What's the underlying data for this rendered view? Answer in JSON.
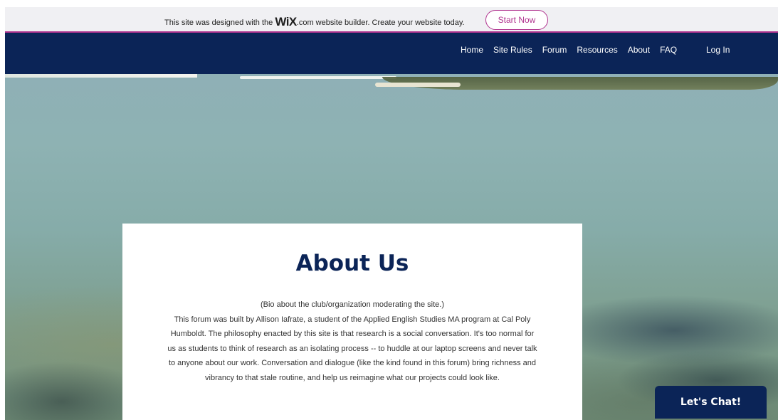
{
  "wix_banner": {
    "text_before": "This site was designed with the ",
    "logo_wix": "WiX",
    "logo_com": ".com",
    "text_after": " website builder. Create your website today.",
    "button_label": "Start Now"
  },
  "header": {
    "nav": [
      "Home",
      "Site Rules",
      "Forum",
      "Resources",
      "About",
      "FAQ"
    ],
    "login_label": "Log In"
  },
  "about": {
    "title": "About Us",
    "subtitle": "(Bio about the club/organization moderating the site.)",
    "lines": [
      "This forum was built by Allison Iafrate, a student of the Applied English Studies MA program at Cal Poly",
      "Humboldt. The philosophy enacted by this site is that research is a social conversation. It's too normal for",
      "us as students to think of research as an isolating process -- to huddle at our laptop screens and never talk",
      "to anyone about our work. Conversation and dialogue (like the kind found in this forum) bring richness and",
      "vibrancy to that stale routine, and help us reimagine what our projects could look like."
    ]
  },
  "chat": {
    "label": "Let's Chat!"
  },
  "colors": {
    "navy": "#0b2457",
    "wix_accent": "#b0338f",
    "banner_bg": "#f0f0f3"
  }
}
